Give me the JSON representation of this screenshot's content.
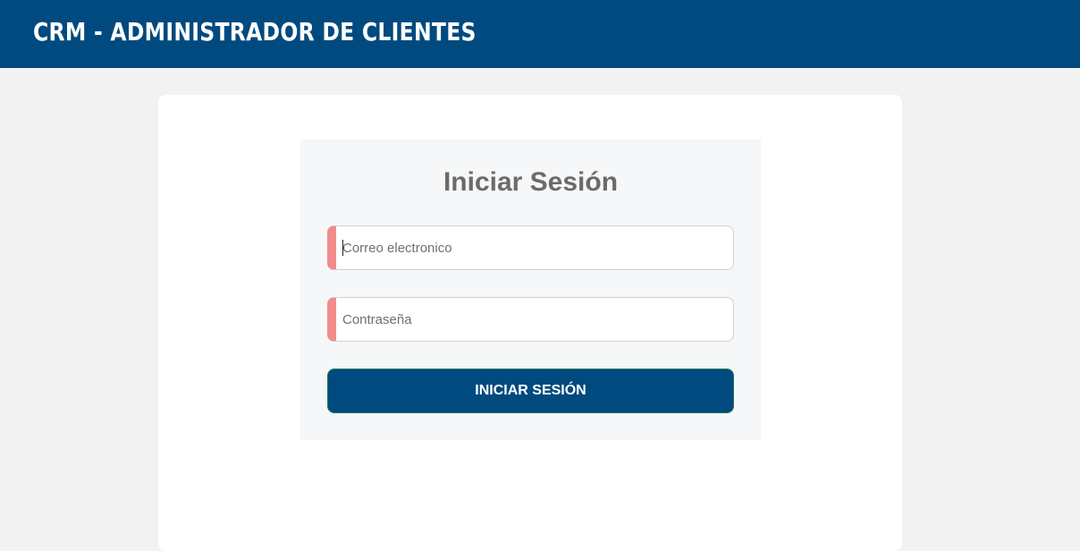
{
  "header": {
    "title": "CRM - ADMINISTRADOR DE CLIENTES"
  },
  "login": {
    "heading": "Iniciar Sesión",
    "email": {
      "value": "",
      "placeholder": "Correo electronico"
    },
    "password": {
      "value": "",
      "placeholder": "Contraseña"
    },
    "submit_label": "INICIAR SESIÓN"
  },
  "colors": {
    "header_bg": "#004a7f",
    "page_bg": "#f2f2f2",
    "field_accent": "#f28b8b",
    "button_bg": "#004a7f"
  }
}
